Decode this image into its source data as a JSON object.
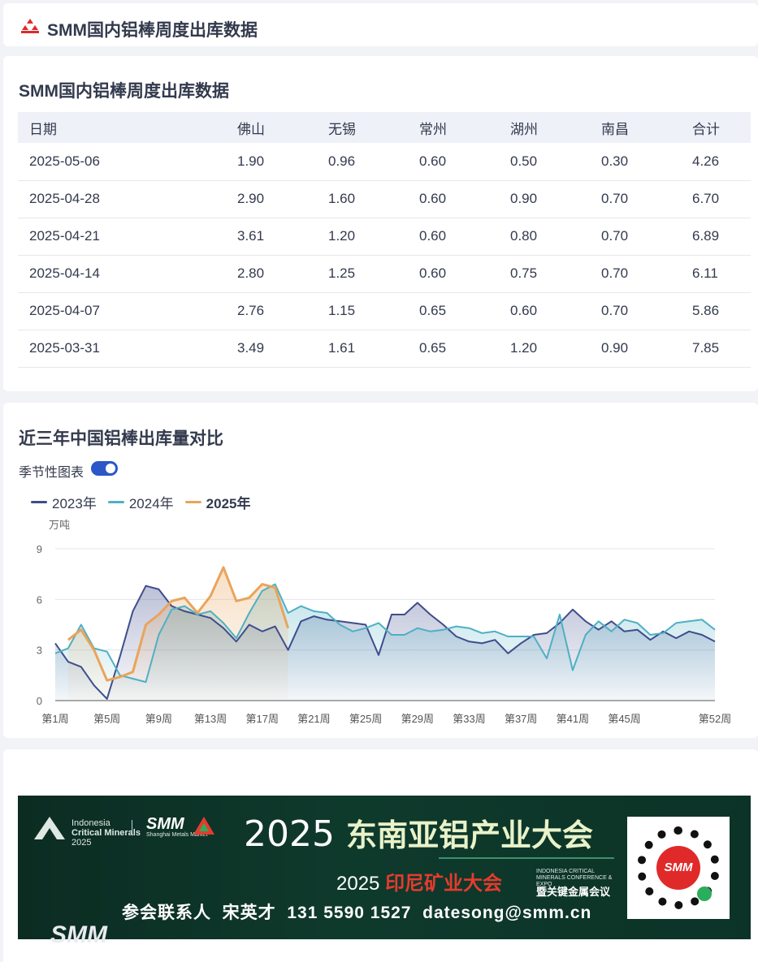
{
  "header": {
    "title": "SMM国内铝棒周度出库数据"
  },
  "table_section": {
    "title": "SMM国内铝棒周度出库数据",
    "columns": [
      "日期",
      "佛山",
      "无锡",
      "常州",
      "湖州",
      "南昌",
      "合计"
    ],
    "rows": [
      [
        "2025-05-06",
        "1.90",
        "0.96",
        "0.60",
        "0.50",
        "0.30",
        "4.26"
      ],
      [
        "2025-04-28",
        "2.90",
        "1.60",
        "0.60",
        "0.90",
        "0.70",
        "6.70"
      ],
      [
        "2025-04-21",
        "3.61",
        "1.20",
        "0.60",
        "0.80",
        "0.70",
        "6.89"
      ],
      [
        "2025-04-14",
        "2.80",
        "1.25",
        "0.60",
        "0.75",
        "0.70",
        "6.11"
      ],
      [
        "2025-04-07",
        "2.76",
        "1.15",
        "0.65",
        "0.60",
        "0.70",
        "5.86"
      ],
      [
        "2025-03-31",
        "3.49",
        "1.61",
        "0.65",
        "1.20",
        "0.90",
        "7.85"
      ]
    ]
  },
  "chart_section": {
    "title": "近三年中国铝棒出库量对比",
    "toggle_label": "季节性图表",
    "toggle_on": true
  },
  "chart_data": {
    "type": "line",
    "yunit": "万吨",
    "ylim": [
      0,
      9
    ],
    "yticks": [
      0,
      3,
      6,
      9
    ],
    "x_ticks": [
      "第1周",
      "第5周",
      "第9周",
      "第13周",
      "第17周",
      "第21周",
      "第25周",
      "第29周",
      "第33周",
      "第37周",
      "第41周",
      "第45周",
      "第52周"
    ],
    "x_tick_weeks": [
      1,
      5,
      9,
      13,
      17,
      21,
      25,
      29,
      33,
      37,
      41,
      45,
      52
    ],
    "grid": true,
    "legend_position": "top-left",
    "series": [
      {
        "name": "2023年",
        "color": "#3f4d8c",
        "weeks": [
          1,
          2,
          3,
          4,
          5,
          6,
          7,
          8,
          9,
          10,
          11,
          12,
          13,
          14,
          15,
          16,
          17,
          18,
          19,
          20,
          21,
          22,
          23,
          24,
          25,
          26,
          27,
          28,
          29,
          30,
          31,
          32,
          33,
          34,
          35,
          36,
          37,
          38,
          39,
          40,
          41,
          42,
          43,
          44,
          45,
          46,
          47,
          48,
          49,
          50,
          51,
          52
        ],
        "values": [
          3.4,
          2.3,
          2.0,
          0.9,
          0.1,
          2.6,
          5.3,
          6.8,
          6.6,
          5.6,
          5.3,
          5.1,
          4.9,
          4.3,
          3.5,
          4.5,
          4.1,
          4.4,
          3.0,
          4.7,
          5.0,
          4.8,
          4.7,
          4.6,
          4.5,
          2.7,
          5.1,
          5.1,
          5.8,
          5.1,
          4.5,
          3.8,
          3.5,
          3.4,
          3.6,
          2.8,
          3.4,
          3.9,
          4.0,
          4.6,
          5.4,
          4.7,
          4.2,
          4.7,
          4.1,
          4.2,
          3.6,
          4.1,
          3.7,
          4.1,
          3.9,
          3.5
        ]
      },
      {
        "name": "2024年",
        "color": "#4eb0c4",
        "weeks": [
          1,
          2,
          3,
          4,
          5,
          6,
          7,
          8,
          9,
          10,
          11,
          12,
          13,
          14,
          15,
          16,
          17,
          18,
          19,
          20,
          21,
          22,
          23,
          24,
          25,
          26,
          27,
          28,
          29,
          30,
          31,
          32,
          33,
          34,
          35,
          36,
          37,
          38,
          39,
          40,
          41,
          42,
          43,
          44,
          45,
          46,
          47,
          48,
          49,
          50,
          51,
          52
        ],
        "values": [
          2.8,
          3.1,
          4.5,
          3.1,
          2.9,
          1.5,
          1.3,
          1.1,
          3.9,
          5.4,
          5.6,
          5.1,
          5.3,
          4.6,
          3.7,
          5.2,
          6.5,
          6.9,
          5.2,
          5.6,
          5.3,
          5.2,
          4.5,
          4.1,
          4.3,
          4.6,
          3.9,
          3.9,
          4.3,
          4.1,
          4.2,
          4.4,
          4.3,
          4.0,
          4.1,
          3.8,
          3.8,
          3.8,
          2.5,
          5.1,
          1.8,
          3.9,
          4.7,
          4.1,
          4.8,
          4.6,
          3.9,
          4.0,
          4.6,
          4.7,
          4.8,
          4.2
        ]
      },
      {
        "name": "2025年",
        "color": "#e9a45a",
        "weeks": [
          2,
          3,
          4,
          5,
          6,
          7,
          8,
          9,
          10,
          11,
          12,
          13,
          14,
          15,
          16,
          17,
          18,
          19
        ],
        "values": [
          3.6,
          4.2,
          3.0,
          1.2,
          1.4,
          1.7,
          4.5,
          5.1,
          5.9,
          6.1,
          5.2,
          6.2,
          7.9,
          5.9,
          6.1,
          6.9,
          6.7,
          4.3
        ]
      }
    ]
  },
  "banner": {
    "logo_text_1": "Indonesia",
    "logo_text_2": "Critical Minerals",
    "logo_text_3": "2025",
    "smm_text": "SMM",
    "smm_sub": "Shanghai Metals Market",
    "big_year": "2025",
    "big_title": "东南亚铝产业大会",
    "sub_year": "2025",
    "sub_title": "印尼矿业大会",
    "sub_en": "INDONESIA CRITICAL MINERALS CONFERENCE & EXPO",
    "sub_cn": "暨关键金属会议",
    "contact_label": "参会联系人",
    "contact_name": "宋英才",
    "contact_phone": "131 5590 1527",
    "contact_email": "datesong@smm.cn",
    "qr_center": "SMM"
  },
  "watermark": "SMM"
}
